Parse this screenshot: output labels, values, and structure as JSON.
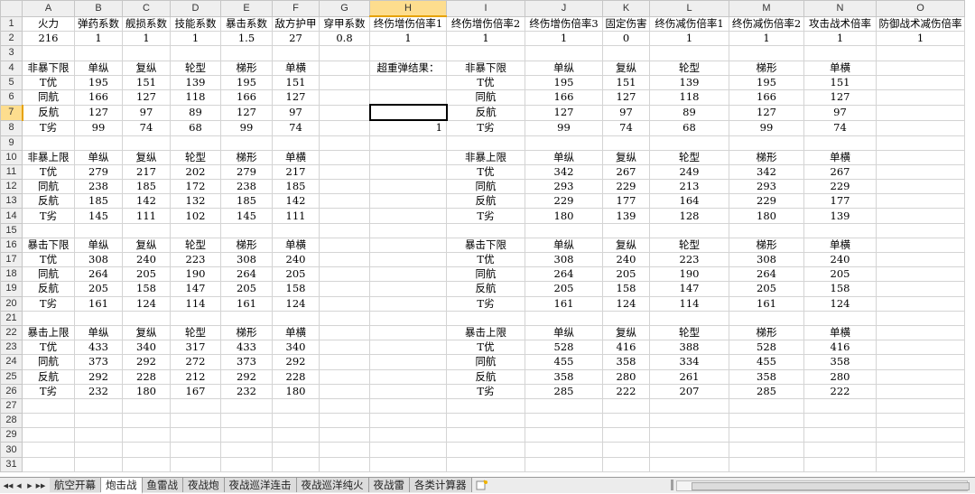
{
  "columns": [
    "A",
    "B",
    "C",
    "D",
    "E",
    "F",
    "G",
    "H",
    "I",
    "J",
    "K",
    "L",
    "M",
    "N",
    "O"
  ],
  "rows": [
    [
      "火力",
      "弹药系数",
      "舰损系数",
      "技能系数",
      "暴击系数",
      "敌方护甲",
      "穿甲系数",
      "终伤增伤倍率1",
      "终伤增伤倍率2",
      "终伤增伤倍率3",
      "固定伤害",
      "终伤减伤倍率1",
      "终伤减伤倍率2",
      "攻击战术倍率",
      "防御战术减伤倍率"
    ],
    [
      "216",
      "1",
      "1",
      "1",
      "1.5",
      "27",
      "0.8",
      "1",
      "1",
      "1",
      "0",
      "1",
      "1",
      "1",
      "1"
    ],
    [
      "",
      "",
      "",
      "",
      "",
      "",
      "",
      "",
      "",
      "",
      "",
      "",
      "",
      "",
      ""
    ],
    [
      "非暴下限",
      "单纵",
      "复纵",
      "轮型",
      "梯形",
      "单横",
      "",
      "超重弹结果：",
      "非暴下限",
      "单纵",
      "复纵",
      "轮型",
      "梯形",
      "单横",
      ""
    ],
    [
      "T优",
      "195",
      "151",
      "139",
      "195",
      "151",
      "",
      "",
      "T优",
      "195",
      "151",
      "139",
      "195",
      "151",
      ""
    ],
    [
      "同航",
      "166",
      "127",
      "118",
      "166",
      "127",
      "",
      "",
      "同航",
      "166",
      "127",
      "118",
      "166",
      "127",
      ""
    ],
    [
      "反航",
      "127",
      "97",
      "89",
      "127",
      "97",
      "",
      "",
      "反航",
      "127",
      "97",
      "89",
      "127",
      "97",
      ""
    ],
    [
      "T劣",
      "99",
      "74",
      "68",
      "99",
      "74",
      "",
      "1",
      "T劣",
      "99",
      "74",
      "68",
      "99",
      "74",
      ""
    ],
    [
      "",
      "",
      "",
      "",
      "",
      "",
      "",
      "",
      "",
      "",
      "",
      "",
      "",
      "",
      ""
    ],
    [
      "非暴上限",
      "单纵",
      "复纵",
      "轮型",
      "梯形",
      "单横",
      "",
      "",
      "非暴上限",
      "单纵",
      "复纵",
      "轮型",
      "梯形",
      "单横",
      ""
    ],
    [
      "T优",
      "279",
      "217",
      "202",
      "279",
      "217",
      "",
      "",
      "T优",
      "342",
      "267",
      "249",
      "342",
      "267",
      ""
    ],
    [
      "同航",
      "238",
      "185",
      "172",
      "238",
      "185",
      "",
      "",
      "同航",
      "293",
      "229",
      "213",
      "293",
      "229",
      ""
    ],
    [
      "反航",
      "185",
      "142",
      "132",
      "185",
      "142",
      "",
      "",
      "反航",
      "229",
      "177",
      "164",
      "229",
      "177",
      ""
    ],
    [
      "T劣",
      "145",
      "111",
      "102",
      "145",
      "111",
      "",
      "",
      "T劣",
      "180",
      "139",
      "128",
      "180",
      "139",
      ""
    ],
    [
      "",
      "",
      "",
      "",
      "",
      "",
      "",
      "",
      "",
      "",
      "",
      "",
      "",
      "",
      ""
    ],
    [
      "暴击下限",
      "单纵",
      "复纵",
      "轮型",
      "梯形",
      "单横",
      "",
      "",
      "暴击下限",
      "单纵",
      "复纵",
      "轮型",
      "梯形",
      "单横",
      ""
    ],
    [
      "T优",
      "308",
      "240",
      "223",
      "308",
      "240",
      "",
      "",
      "T优",
      "308",
      "240",
      "223",
      "308",
      "240",
      ""
    ],
    [
      "同航",
      "264",
      "205",
      "190",
      "264",
      "205",
      "",
      "",
      "同航",
      "264",
      "205",
      "190",
      "264",
      "205",
      ""
    ],
    [
      "反航",
      "205",
      "158",
      "147",
      "205",
      "158",
      "",
      "",
      "反航",
      "205",
      "158",
      "147",
      "205",
      "158",
      ""
    ],
    [
      "T劣",
      "161",
      "124",
      "114",
      "161",
      "124",
      "",
      "",
      "T劣",
      "161",
      "124",
      "114",
      "161",
      "124",
      ""
    ],
    [
      "",
      "",
      "",
      "",
      "",
      "",
      "",
      "",
      "",
      "",
      "",
      "",
      "",
      "",
      ""
    ],
    [
      "暴击上限",
      "单纵",
      "复纵",
      "轮型",
      "梯形",
      "单横",
      "",
      "",
      "暴击上限",
      "单纵",
      "复纵",
      "轮型",
      "梯形",
      "单横",
      ""
    ],
    [
      "T优",
      "433",
      "340",
      "317",
      "433",
      "340",
      "",
      "",
      "T优",
      "528",
      "416",
      "388",
      "528",
      "416",
      ""
    ],
    [
      "同航",
      "373",
      "292",
      "272",
      "373",
      "292",
      "",
      "",
      "同航",
      "455",
      "358",
      "334",
      "455",
      "358",
      ""
    ],
    [
      "反航",
      "292",
      "228",
      "212",
      "292",
      "228",
      "",
      "",
      "反航",
      "358",
      "280",
      "261",
      "358",
      "280",
      ""
    ],
    [
      "T劣",
      "232",
      "180",
      "167",
      "232",
      "180",
      "",
      "",
      "T劣",
      "285",
      "222",
      "207",
      "285",
      "222",
      ""
    ],
    [
      "",
      "",
      "",
      "",
      "",
      "",
      "",
      "",
      "",
      "",
      "",
      "",
      "",
      "",
      ""
    ],
    [
      "",
      "",
      "",
      "",
      "",
      "",
      "",
      "",
      "",
      "",
      "",
      "",
      "",
      "",
      ""
    ],
    [
      "",
      "",
      "",
      "",
      "",
      "",
      "",
      "",
      "",
      "",
      "",
      "",
      "",
      "",
      ""
    ],
    [
      "",
      "",
      "",
      "",
      "",
      "",
      "",
      "",
      "",
      "",
      "",
      "",
      "",
      "",
      ""
    ],
    [
      "",
      "",
      "",
      "",
      "",
      "",
      "",
      "",
      "",
      "",
      "",
      "",
      "",
      "",
      ""
    ]
  ],
  "selection": {
    "column": "H",
    "row": "7"
  },
  "sheet_nav": [
    "◀◀",
    "◀",
    "▶",
    "▶▶"
  ],
  "sheet_tabs": [
    "航空开幕",
    "炮击战",
    "鱼雷战",
    "夜战炮",
    "夜战巡洋连击",
    "夜战巡洋纯火",
    "夜战雷",
    "各类计算器"
  ],
  "active_tab": "炮击战",
  "new_sheet_icon": "new-sheet-icon"
}
